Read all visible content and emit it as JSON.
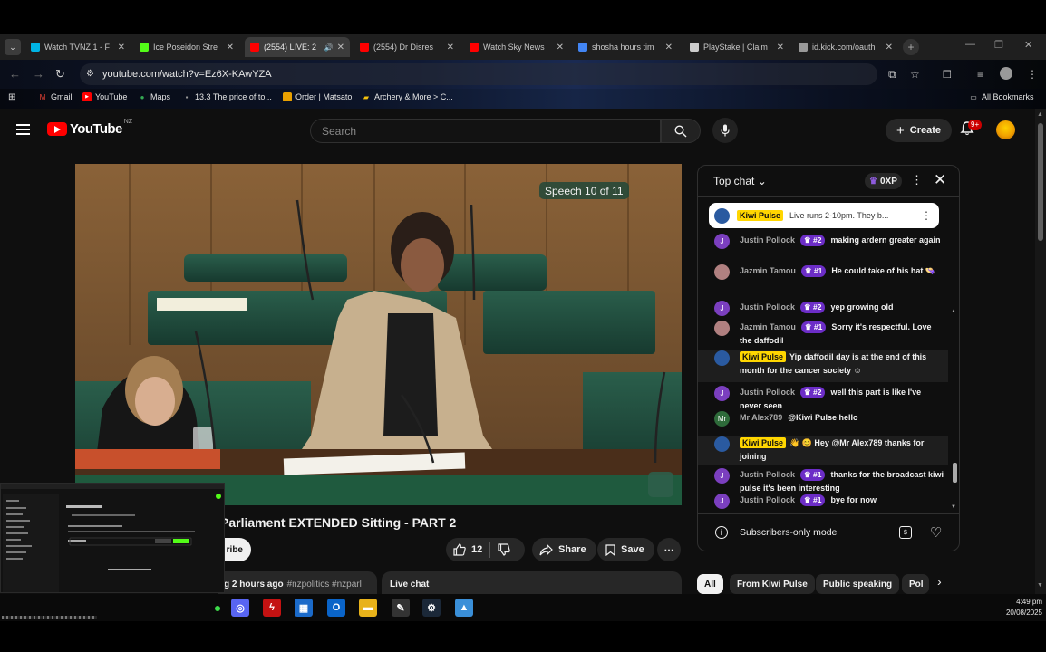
{
  "browser": {
    "tabs": [
      {
        "title": "Watch TVNZ 1 - F",
        "icon": "tvnz-icon",
        "color": "#00b4e4",
        "active": false
      },
      {
        "title": "Ice Poseidon Stre",
        "icon": "kick-icon",
        "color": "#53fc18",
        "active": false
      },
      {
        "title": "(2554) LIVE: 2",
        "icon": "youtube-icon",
        "color": "#ff0000",
        "active": true
      },
      {
        "title": "(2554) Dr Disres",
        "icon": "youtube-icon",
        "color": "#ff0000",
        "active": false
      },
      {
        "title": "Watch Sky News",
        "icon": "youtube-icon",
        "color": "#ff0000",
        "active": false
      },
      {
        "title": "shosha hours tim",
        "icon": "google-icon",
        "color": "#4285f4",
        "active": false
      },
      {
        "title": "PlayStake | Claim",
        "icon": "playstake-icon",
        "color": "#cccccc",
        "active": false
      },
      {
        "title": "id.kick.com/oauth",
        "icon": "globe-icon",
        "color": "#999999",
        "active": false
      }
    ],
    "url": "youtube.com/watch?v=Ez6X-KAwYZA",
    "bookmarks": [
      {
        "label": "Gmail",
        "icon": "gmail-icon"
      },
      {
        "label": "YouTube",
        "icon": "youtube-icon"
      },
      {
        "label": "Maps",
        "icon": "maps-icon"
      },
      {
        "label": "13.3 The price of to...",
        "icon": "bookmark-icon"
      },
      {
        "label": "Order | Matsato",
        "icon": "matsato-icon"
      },
      {
        "label": "Archery & More > C...",
        "icon": "folder-icon"
      }
    ],
    "all_bookmarks": "All Bookmarks"
  },
  "youtube": {
    "logo_text": "YouTube",
    "region": "NZ",
    "search_placeholder": "Search",
    "create_label": "Create",
    "notification_count": "9+",
    "speech_badge": "Speech 10 of 11",
    "video_title": "Parliament EXTENDED Sitting - PART 2",
    "subscribe_label": "ribe",
    "like_count": "12",
    "share_label": "Share",
    "save_label": "Save",
    "description_meta": "g 2 hours ago",
    "description_tags": "#nzpolitics #nzparl",
    "live_chat_label": "Live chat"
  },
  "chat": {
    "header_title": "Top chat",
    "xp_label": "0XP",
    "pinned": {
      "author": "Kiwi Pulse",
      "text": "Live runs 2-10pm. They b..."
    },
    "messages": [
      {
        "author": "Justin Pollock",
        "rank": "#2",
        "text": "making ardern greater again",
        "avatar": "J",
        "avatar_color": "#7b3fbf",
        "owner": false
      },
      {
        "author": "Jazmin Tamou",
        "rank": "#1",
        "text": "He could take of his hat 👒",
        "avatar": "",
        "avatar_color": "#b08080",
        "owner": false
      },
      {
        "author": "Justin Pollock",
        "rank": "#2",
        "text": "yep growing old",
        "avatar": "J",
        "avatar_color": "#7b3fbf",
        "owner": false
      },
      {
        "author": "Jazmin Tamou",
        "rank": "#1",
        "text": "Sorry it's respectful. Love the daffodil",
        "avatar": "",
        "avatar_color": "#b08080",
        "owner": false
      },
      {
        "author": "Kiwi Pulse",
        "rank": "",
        "text": "Yip daffodil day is at the end of this month for the cancer society ☺",
        "avatar": "",
        "avatar_color": "#2a5aa0",
        "owner": true
      },
      {
        "author": "Justin Pollock",
        "rank": "#2",
        "text": "well this part is like I've never seen",
        "avatar": "J",
        "avatar_color": "#7b3fbf",
        "owner": false
      },
      {
        "author": "Mr Alex789",
        "rank": "",
        "text": "@Kiwi Pulse hello",
        "avatar": "Mr",
        "avatar_color": "#2e6b3a",
        "owner": false
      },
      {
        "author": "Kiwi Pulse",
        "rank": "",
        "text": "👋 😊 Hey @Mr Alex789 thanks for joining",
        "avatar": "",
        "avatar_color": "#2a5aa0",
        "owner": true
      },
      {
        "author": "Justin Pollock",
        "rank": "#1",
        "text": "thanks for the broadcast kiwi pulse it's been interesting",
        "avatar": "J",
        "avatar_color": "#7b3fbf",
        "owner": false
      },
      {
        "author": "Justin Pollock",
        "rank": "#1",
        "text": "bye for now",
        "avatar": "J",
        "avatar_color": "#7b3fbf",
        "owner": false
      }
    ],
    "footer_mode": "Subscribers-only mode"
  },
  "chips": [
    "All",
    "From Kiwi Pulse",
    "Public speaking",
    "Pol"
  ],
  "taskbar": {
    "time": "4:49 pm",
    "date": "20/08/2025"
  }
}
